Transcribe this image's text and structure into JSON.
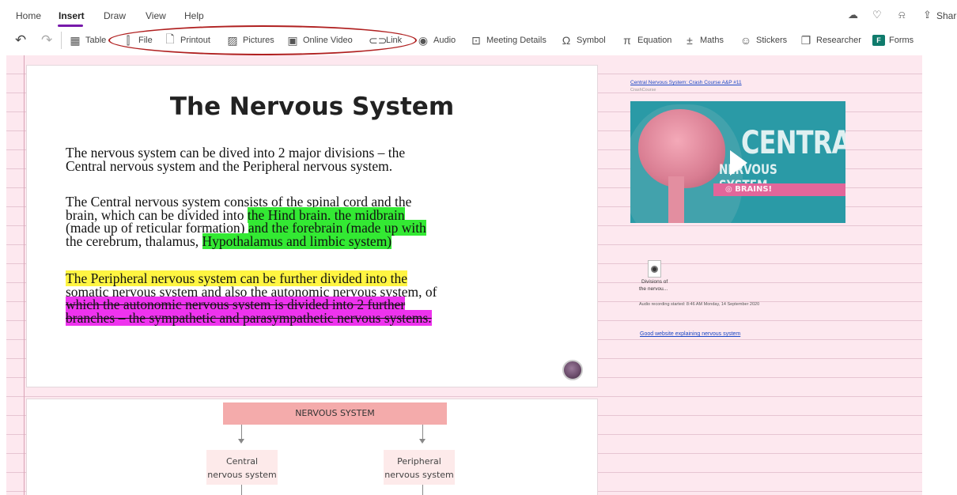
{
  "tabs": [
    {
      "label": "Home"
    },
    {
      "label": "Insert"
    },
    {
      "label": "Draw"
    },
    {
      "label": "View"
    },
    {
      "label": "Help"
    }
  ],
  "topright": {
    "share_label": "Share"
  },
  "toolbar": {
    "items": [
      {
        "label": "Table",
        "icon": "table-icon"
      },
      {
        "label": "File",
        "icon": "file-attach-icon"
      },
      {
        "label": "Printout",
        "icon": "printout-icon"
      },
      {
        "label": "Pictures",
        "icon": "picture-icon"
      },
      {
        "label": "Online Video",
        "icon": "online-video-icon"
      },
      {
        "label": "Link",
        "icon": "link-icon"
      },
      {
        "label": "Audio",
        "icon": "audio-icon"
      },
      {
        "label": "Meeting Details",
        "icon": "meeting-icon"
      },
      {
        "label": "Symbol",
        "icon": "omega-icon"
      },
      {
        "label": "Equation",
        "icon": "pi-icon"
      },
      {
        "label": "Maths",
        "icon": "maths-icon"
      },
      {
        "label": "Stickers",
        "icon": "sticker-icon"
      },
      {
        "label": "Researcher",
        "icon": "researcher-icon"
      },
      {
        "label": "Forms",
        "icon": "forms-icon"
      }
    ]
  },
  "slide1": {
    "title": "The Nervous System",
    "p1": {
      "line1": "The nervous system can be dived into 2 major divisions – the",
      "line2": "Central nervous system and the Peripheral nervous system."
    },
    "p2": {
      "line1": "The Central nervous system consists of the spinal cord and the",
      "line2_plain": "brain, which can be divided into ",
      "line2_hl": "the Hind brain, the midbrain",
      "line3_plain": "(made up of reticular formation) ",
      "line3_hl": "and the forebrain (made up with",
      "line4_plain": "the cerebrum, thalamus, ",
      "line4_hl": "Hypothalamus and limbic system)"
    },
    "p3": {
      "line1_hl": "The Peripheral nervous system can be further divided into the",
      "line2": "somatic nervous system and also the autonomic nervous system, of",
      "line3_hl": "which the autonomic nervous system is divided into 2 further",
      "line4_hl": "branches – the sympathetic and parasympathetic nervous systems."
    }
  },
  "slide2": {
    "top_box": "NERVOUS SYSTEM",
    "left_box_line1": "Central",
    "left_box_line2": "nervous system",
    "right_box_line1": "Peripheral",
    "right_box_line2": "nervous system"
  },
  "right_column": {
    "video_title": "Central Nervous System: Crash Course A&P #11",
    "video_source": "CrashCourse",
    "thumb_title": "CENTRAL",
    "thumb_subtitle": "NERVOUS SYSTEM",
    "thumb_band": "◎ BRAINS!",
    "file_name_line1": "Divisions of",
    "file_name_line2": "the nervou...",
    "recording_text": "Audio recording started: 8:46 AM Monday, 14 September 2020",
    "website_link": "Good website explaining nervous system"
  }
}
